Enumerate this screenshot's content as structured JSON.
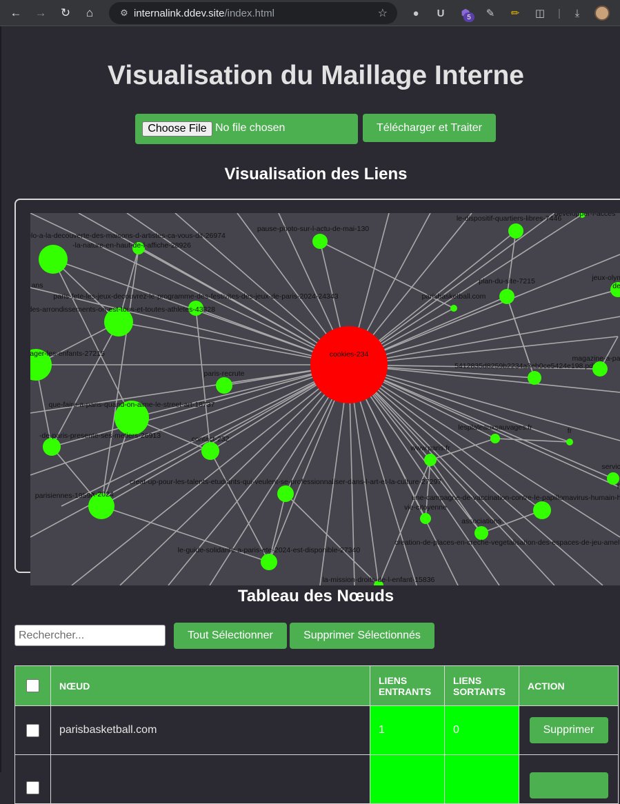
{
  "browser": {
    "url_host": "internalink.ddev.site",
    "url_path": "/index.html",
    "extension_badge": "5"
  },
  "page": {
    "title": "Visualisation du Maillage Interne",
    "file_button": "Choose File",
    "file_status": "No file chosen",
    "upload_button": "Télécharger et Traiter",
    "graph_title": "Visualisation des Liens",
    "table_title": "Tableau des Nœuds",
    "search_placeholder": "Rechercher...",
    "select_all_button": "Tout Sélectionner",
    "delete_selected_button": "Supprimer Sélectionnés"
  },
  "colors": {
    "accent": "#4caf50",
    "hub_node": "#ff0000",
    "node": "#33ff00",
    "link": "#aaaaaa",
    "background": "#2b2a33"
  },
  "graph": {
    "hub": "cookies-234",
    "nodes": [
      {
        "label": "cookies-234",
        "type": "hub"
      },
      {
        "label": "pause-photo-sur-l-actu-de-mai-130"
      },
      {
        "label": "le-dispositif-quartiers-libres-7446"
      },
      {
        "label": "developper-l-acces"
      },
      {
        "label": "ide-a-velo-a-la-decouverte-des-maisons-d-artistes-ca-vous-dit-26974"
      },
      {
        "label": "-la-nature-en-haut-de-l-affiche-28926"
      },
      {
        "label": "ans"
      },
      {
        "label": "paris-fete-les-jeux-decouvrez-le-programme-des-festivites-des-jeux-de-paris-2024-24343"
      },
      {
        "label": "s-des-arrondissements-on-est-tous-et-toutes-athletes-43328"
      },
      {
        "label": "parisbasketball.com"
      },
      {
        "label": "plan-du-site-7215"
      },
      {
        "label": "jeux-olympiques-et-parat"
      },
      {
        "label": "des-cours-d"
      },
      {
        "label": "paris"
      },
      {
        "label": "oyager-les-enfants-27215"
      },
      {
        "label": "paris-recrute"
      },
      {
        "label": "5412835d8259b2234a3eb0ce5424e198.pdf"
      },
      {
        "label": "magazine-a-paris"
      },
      {
        "label": "que-faire-a-paris-quand-on-aime-le-street-art-18737"
      },
      {
        "label": "-de-paris-presente-ses-metiers-26913"
      },
      {
        "label": "contact-232"
      },
      {
        "label": "lesplateauxsauvages.fr"
      },
      {
        "label": "fr"
      },
      {
        "label": "www.paris.fr"
      },
      {
        "label": "parisiennes-19596"
      },
      {
        "label": "-x-2024"
      },
      {
        "label": "creat-up-pour-les-talents-etudiants-qui-veulent-se-professionnaliser-dans-l-art-et-la-culture-27297"
      },
      {
        "label": "service"
      },
      {
        "label": "pl"
      },
      {
        "label": "une-campagne-de-vaccination-contre-le-papillomavirus-humain-hpv-"
      },
      {
        "label": "vie-citoyenne"
      },
      {
        "label": "associations"
      },
      {
        "label": "creation-de-places-en-creche-vegetalisation-des-espaces-de-jeu-ameliora"
      },
      {
        "label": "le-guide-solidarite-a-paris-ete-2024-est-disponible-27340"
      },
      {
        "label": "la-mission-droits-de-l-enfant-15836"
      }
    ]
  },
  "table": {
    "headers": [
      "",
      "Nœud",
      "Liens Entrants",
      "Liens Sortants",
      "Action"
    ],
    "rows": [
      {
        "node": "parisbasketball.com",
        "incoming": "1",
        "outgoing": "0",
        "action": "Supprimer"
      },
      {
        "node": "",
        "incoming": "",
        "outgoing": "",
        "action": ""
      }
    ]
  }
}
